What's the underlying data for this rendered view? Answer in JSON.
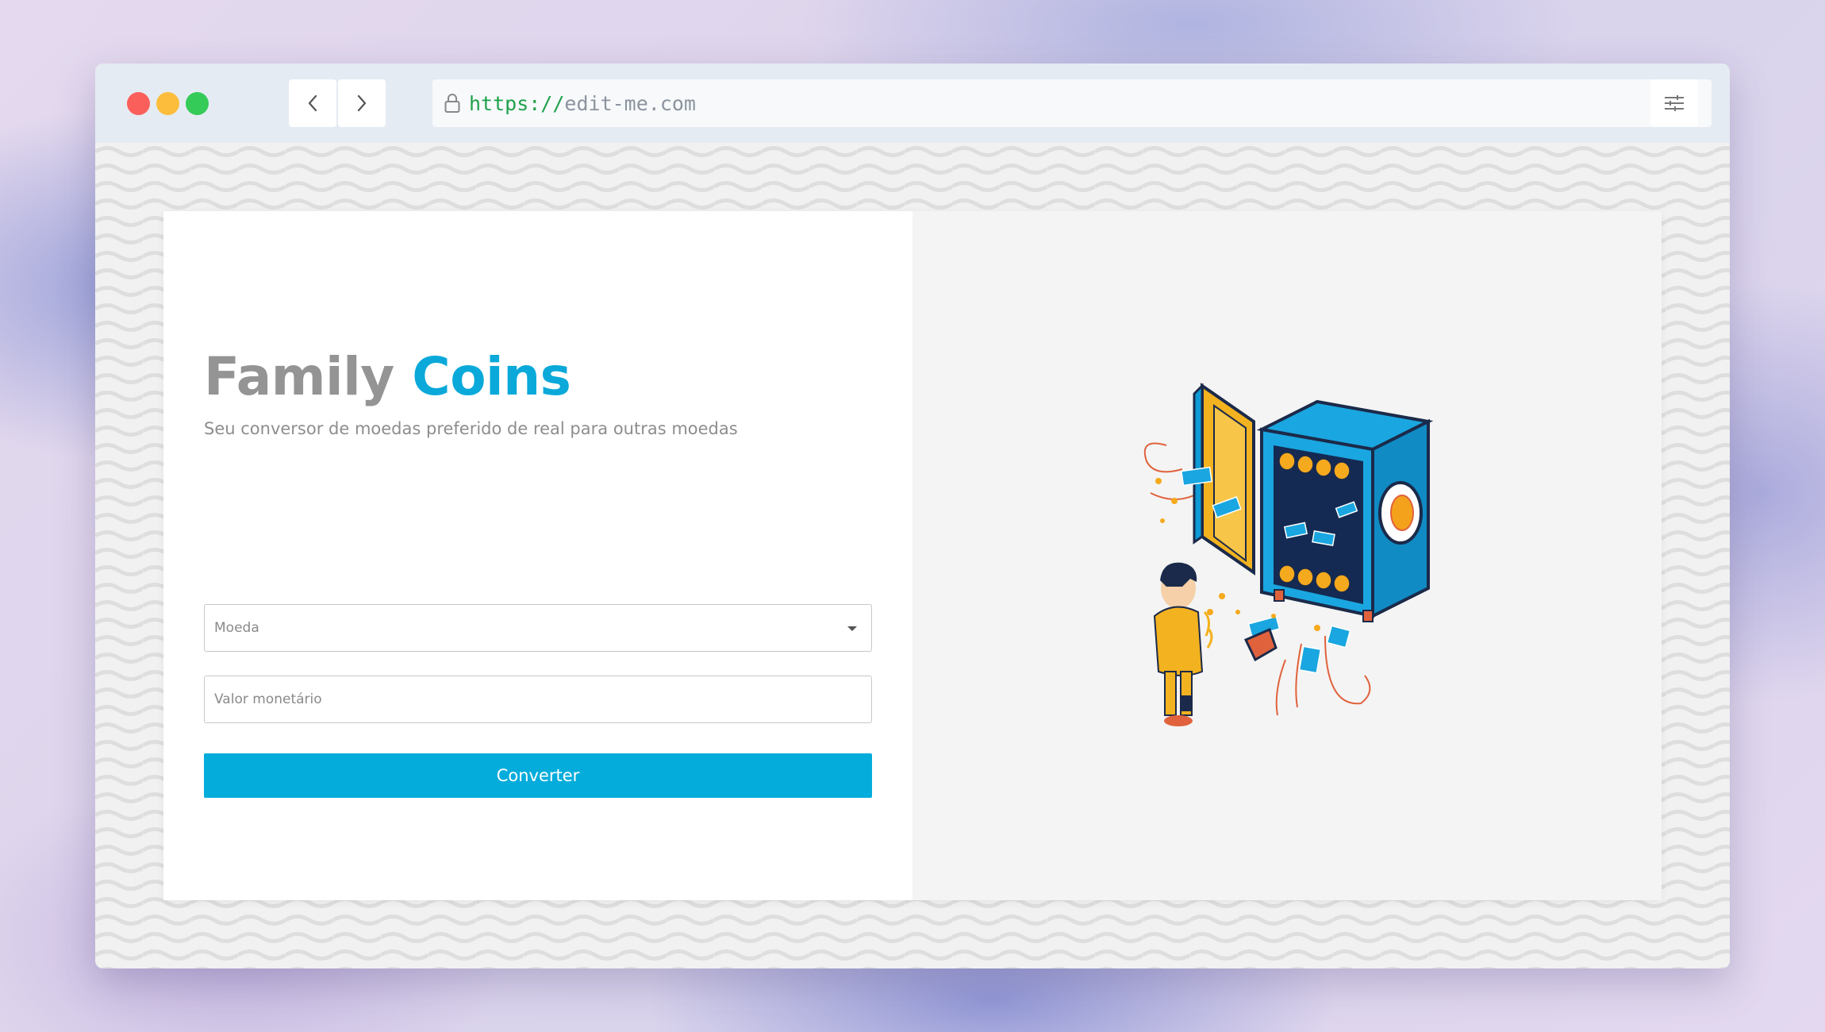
{
  "browser": {
    "url_protocol": "https://",
    "url_host": "edit-me.com"
  },
  "app": {
    "brand_word1": "Family",
    "brand_word2": "Coins",
    "tagline": "Seu conversor de moedas preferido de real para outras moedas"
  },
  "form": {
    "currency_select_label": "Moeda",
    "amount_placeholder": "Valor monetário",
    "convert_label": "Converter"
  },
  "colors": {
    "accent": "#04acdc",
    "brand_gray": "#949494"
  },
  "icons": {
    "back": "chevron-left-icon",
    "forward": "chevron-right-icon",
    "lock": "lock-icon",
    "settings": "sliders-icon",
    "dropdown": "caret-down-icon"
  }
}
